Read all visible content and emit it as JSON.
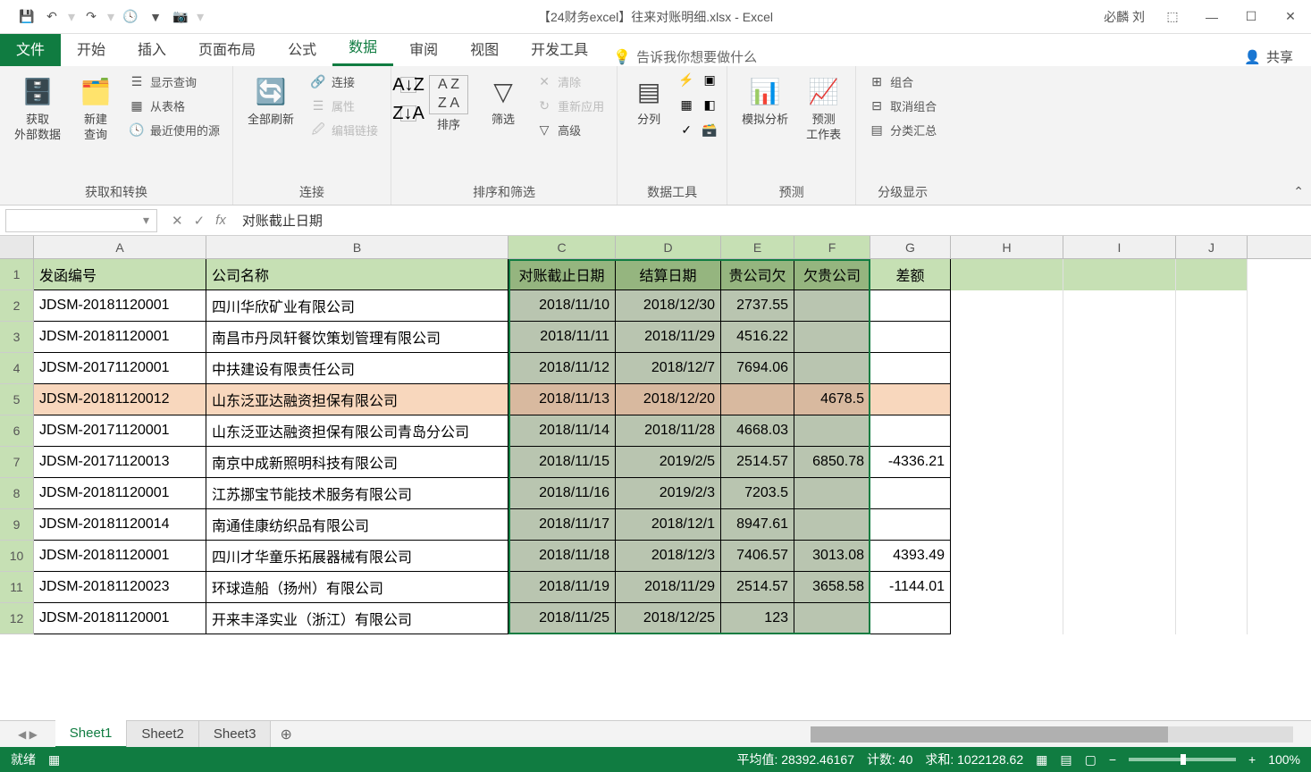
{
  "title": "【24财务excel】往来对账明细.xlsx - Excel",
  "user": "必麟 刘",
  "tabs": {
    "file": "文件",
    "home": "开始",
    "insert": "插入",
    "layout": "页面布局",
    "formula": "公式",
    "data": "数据",
    "review": "审阅",
    "view": "视图",
    "dev": "开发工具"
  },
  "tellme": "告诉我你想要做什么",
  "share": "共享",
  "ribbon": {
    "g1": {
      "label": "获取和转换",
      "ext": "获取\n外部数据",
      "newq": "新建\n查询",
      "show": "显示查询",
      "table": "从表格",
      "recent": "最近使用的源"
    },
    "g2": {
      "label": "连接",
      "refresh": "全部刷新",
      "conn": "连接",
      "prop": "属性",
      "edit": "编辑链接"
    },
    "g3": {
      "label": "排序和筛选",
      "sort": "排序",
      "filter": "筛选",
      "clear": "清除",
      "reapply": "重新应用",
      "adv": "高级"
    },
    "g4": {
      "label": "数据工具",
      "split": "分列"
    },
    "g5": {
      "label": "预测",
      "whatif": "模拟分析",
      "forecast": "预测\n工作表"
    },
    "g6": {
      "label": "分级显示",
      "group": "组合",
      "ungroup": "取消组合",
      "subtotal": "分类汇总"
    }
  },
  "formula_bar": "对账截止日期",
  "cols": [
    "A",
    "B",
    "C",
    "D",
    "E",
    "F",
    "G",
    "H",
    "I",
    "J"
  ],
  "headers": {
    "A": "发函编号",
    "B": "公司名称",
    "C": "对账截止日期",
    "D": "结算日期",
    "E": "贵公司欠",
    "F": "欠贵公司",
    "G": "差额"
  },
  "rows": [
    {
      "A": "JDSM-20181120001",
      "B": "四川华欣矿业有限公司",
      "C": "2018/11/10",
      "D": "2018/12/30",
      "E": "2737.55",
      "F": "",
      "G": ""
    },
    {
      "A": "JDSM-20181120001",
      "B": "南昌市丹凤轩餐饮策划管理有限公司",
      "C": "2018/11/11",
      "D": "2018/11/29",
      "E": "4516.22",
      "F": "",
      "G": ""
    },
    {
      "A": "JDSM-20171120001",
      "B": "中扶建设有限责任公司",
      "C": "2018/11/12",
      "D": "2018/12/7",
      "E": "7694.06",
      "F": "",
      "G": ""
    },
    {
      "A": "JDSM-20181120012",
      "B": "山东泛亚达融资担保有限公司",
      "C": "2018/11/13",
      "D": "2018/12/20",
      "E": "",
      "F": "4678.5",
      "G": "",
      "hl": true
    },
    {
      "A": "JDSM-20171120001",
      "B": "山东泛亚达融资担保有限公司青岛分公司",
      "C": "2018/11/14",
      "D": "2018/11/28",
      "E": "4668.03",
      "F": "",
      "G": ""
    },
    {
      "A": "JDSM-20171120013",
      "B": "南京中成新照明科技有限公司",
      "C": "2018/11/15",
      "D": "2019/2/5",
      "E": "2514.57",
      "F": "6850.78",
      "G": "-4336.21"
    },
    {
      "A": "JDSM-20181120001",
      "B": "江苏挪宝节能技术服务有限公司",
      "C": "2018/11/16",
      "D": "2019/2/3",
      "E": "7203.5",
      "F": "",
      "G": ""
    },
    {
      "A": "JDSM-20181120014",
      "B": "南通佳康纺织品有限公司",
      "C": "2018/11/17",
      "D": "2018/12/1",
      "E": "8947.61",
      "F": "",
      "G": ""
    },
    {
      "A": "JDSM-20181120001",
      "B": "四川才华童乐拓展器械有限公司",
      "C": "2018/11/18",
      "D": "2018/12/3",
      "E": "7406.57",
      "F": "3013.08",
      "G": "4393.49"
    },
    {
      "A": "JDSM-20181120023",
      "B": "环球造船（扬州）有限公司",
      "C": "2018/11/19",
      "D": "2018/11/29",
      "E": "2514.57",
      "F": "3658.58",
      "G": "-1144.01"
    },
    {
      "A": "JDSM-20181120001",
      "B": "开来丰泽实业（浙江）有限公司",
      "C": "2018/11/25",
      "D": "2018/12/25",
      "E": "123",
      "F": "",
      "G": ""
    }
  ],
  "sheets": [
    "Sheet1",
    "Sheet2",
    "Sheet3"
  ],
  "status": {
    "ready": "就绪",
    "avg_l": "平均值:",
    "avg": "28392.46167",
    "cnt_l": "计数:",
    "cnt": "40",
    "sum_l": "求和:",
    "sum": "1022128.62",
    "zoom": "100%"
  }
}
